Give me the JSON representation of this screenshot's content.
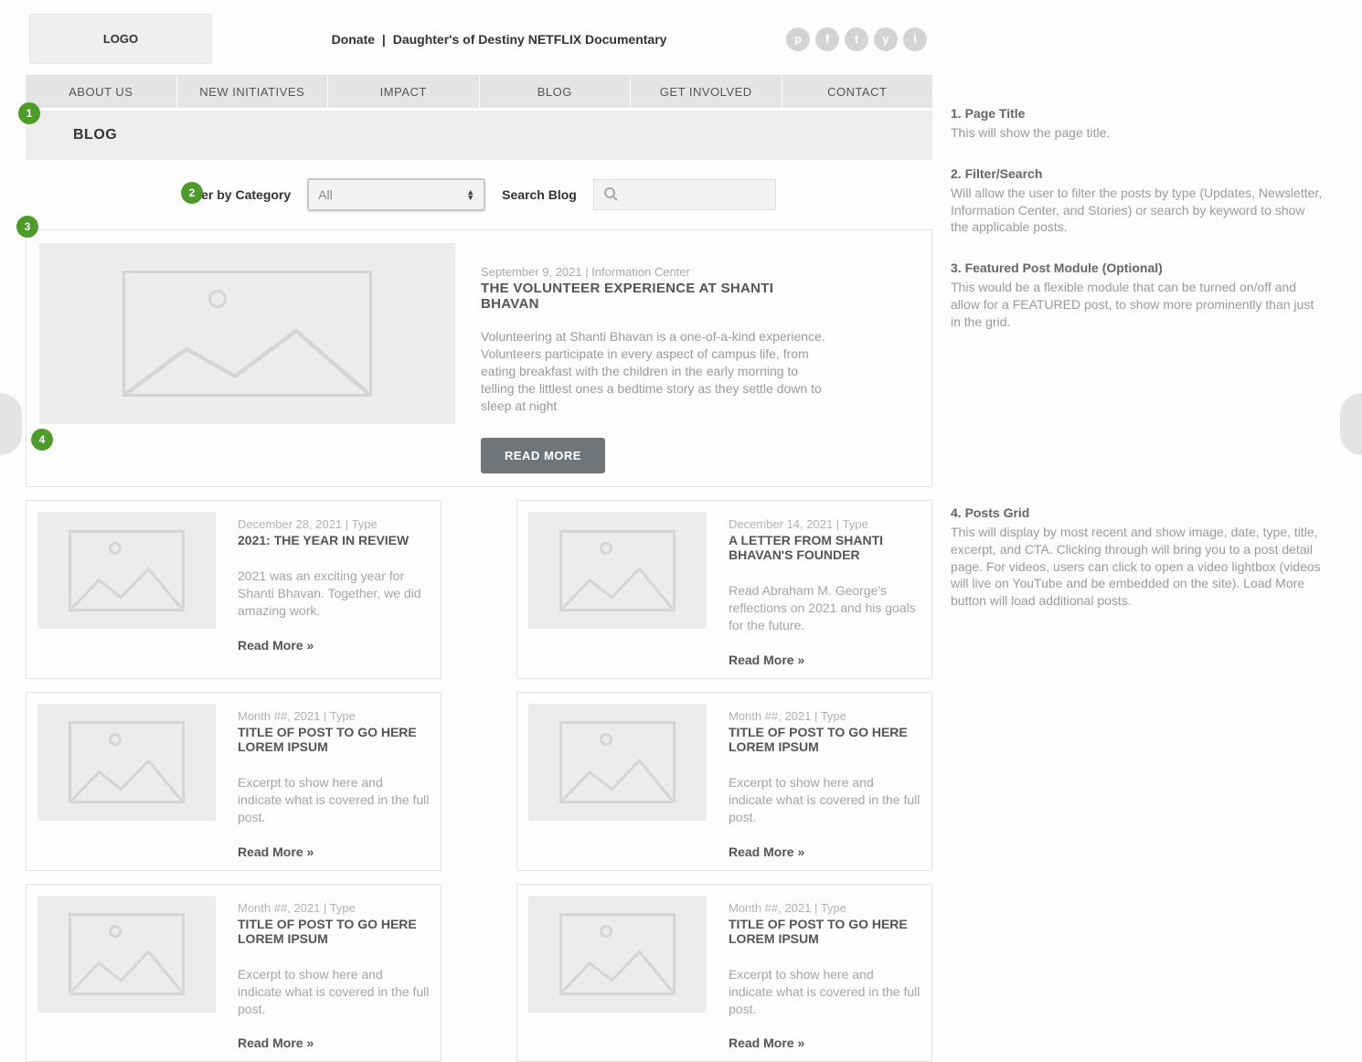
{
  "header": {
    "logo_text": "LOGO",
    "link_donate": "Donate",
    "link_sep": "|",
    "link_doc": "Daughter's of Destiny NETFLIX Documentary",
    "social": [
      "p",
      "f",
      "t",
      "y",
      "i"
    ]
  },
  "nav": {
    "items": [
      "ABOUT US",
      "NEW INITIATIVES",
      "IMPACT",
      "BLOG",
      "GET INVOLVED",
      "CONTACT"
    ]
  },
  "page_title": "BLOG",
  "filter": {
    "label": "Filter by Category",
    "selected": "All",
    "search_label": "Search Blog",
    "search_placeholder": ""
  },
  "featured": {
    "meta": "September 9, 2021 | Information Center",
    "title": "THE VOLUNTEER EXPERIENCE AT SHANTI BHAVAN",
    "excerpt": "Volunteering at Shanti Bhavan is a one-of-a-kind experience. Volunteers participate in every aspect of campus life, from eating breakfast with the children in the early morning to telling the littlest ones a bedtime story as they settle down to sleep at night",
    "cta": "READ MORE"
  },
  "posts": [
    {
      "meta": "December 28, 2021 | Type",
      "title": "2021: THE YEAR IN REVIEW",
      "excerpt": "2021 was an exciting year for Shanti Bhavan. Together, we did amazing work.",
      "cta": "Read More »"
    },
    {
      "meta": "December 14, 2021 | Type",
      "title": "A LETTER FROM SHANTI BHAVAN'S FOUNDER",
      "excerpt": "Read Abraham M. George's reflections on 2021 and his goals for the future.",
      "cta": "Read More »"
    },
    {
      "meta": "Month ##, 2021 | Type",
      "title": "TITLE OF POST TO GO HERE LOREM IPSUM",
      "excerpt": "Excerpt to show here and indicate what is covered in the full post.",
      "cta": "Read More »"
    },
    {
      "meta": "Month ##, 2021 | Type",
      "title": "TITLE OF POST TO GO HERE LOREM IPSUM",
      "excerpt": "Excerpt to show here and indicate what is covered in the full post.",
      "cta": "Read More »"
    },
    {
      "meta": "Month ##, 2021 | Type",
      "title": "TITLE OF POST TO GO HERE LOREM IPSUM",
      "excerpt": "Excerpt to show here and indicate what is covered in the full post.",
      "cta": "Read More »"
    },
    {
      "meta": "Month ##, 2021 | Type",
      "title": "TITLE OF POST TO GO HERE LOREM IPSUM",
      "excerpt": "Excerpt to show here and indicate what is covered in the full post.",
      "cta": "Read More »"
    }
  ],
  "annotations": [
    {
      "num": "1",
      "title": "1. Page Title",
      "body": "This will show the page title."
    },
    {
      "num": "2",
      "title": "2. Filter/Search",
      "body": "Will allow the user to filter the posts by type (Updates, Newsletter, Information Center, and Stories) or search by keyword to show the applicable posts."
    },
    {
      "num": "3",
      "title": "3. Featured Post Module (Optional)",
      "body": "This would be a flexible module that can be turned on/off and allow for a FEATURED post, to show more prominently than just in the grid."
    },
    {
      "num": "4",
      "title": "4. Posts Grid",
      "body": "This will display by most recent and show image, date, type, title, excerpt, and CTA. Clicking through will bring you to a post detail page. For videos, users can click to open a video lightbox (videos will live on YouTube and be embedded on the site). Load More button will load additional posts."
    }
  ]
}
